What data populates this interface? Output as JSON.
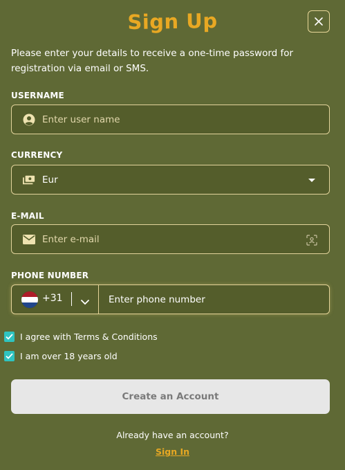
{
  "title": "Sign Up",
  "intro": "Please enter your details to receive a one-time password for registration via email or SMS.",
  "username": {
    "label": "USERNAME",
    "placeholder": "Enter user name",
    "icon": "user-icon"
  },
  "currency": {
    "label": "CURRENCY",
    "value": "Eur",
    "icon": "cash-icon"
  },
  "email": {
    "label": "E-MAIL",
    "placeholder": "Enter e-mail",
    "icon": "mail-icon"
  },
  "phone": {
    "label": "PHONE NUMBER",
    "country_code": "+31",
    "placeholder": "Enter phone number",
    "flag": "netherlands-flag"
  },
  "checks": {
    "terms": "I agree with Terms & Conditions",
    "age": "I am over 18 years old"
  },
  "submit_label": "Create an Account",
  "already_text": "Already have an account?",
  "signin_label": "Sign In",
  "colors": {
    "background": "#5f6935",
    "accent": "#e8a823",
    "checkbox": "#2fc4c0",
    "field_border": "#e3d49c",
    "button_bg": "#e7e7e7"
  }
}
